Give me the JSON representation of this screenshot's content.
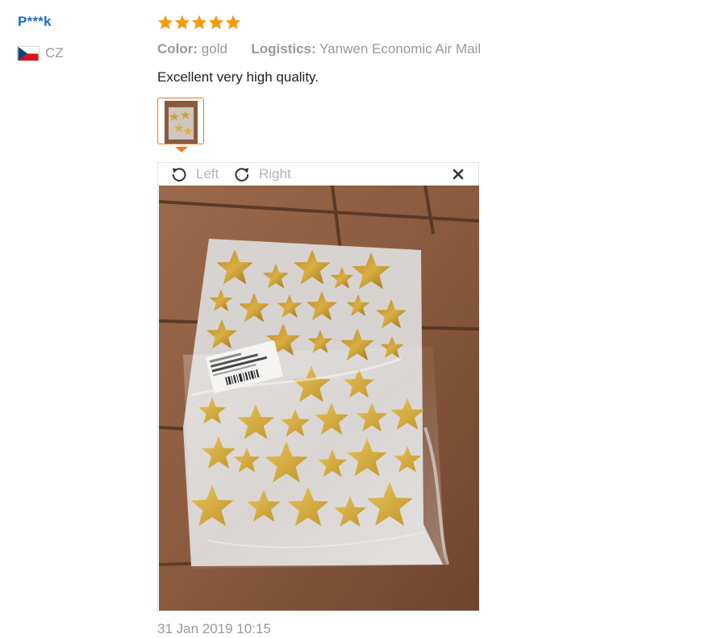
{
  "user": {
    "name": "P***k",
    "country_code": "CZ",
    "flag_icon": "czech-flag-icon"
  },
  "review": {
    "rating": 5,
    "rating_max": 5,
    "star_color": "#f39c12",
    "color_label": "Color:",
    "color_value": "gold",
    "logistics_label": "Logistics:",
    "logistics_value": "Yanwen Economic Air Mail",
    "text": "Excellent very high quality.",
    "date": "31 Jan 2019 10:15"
  },
  "viewer": {
    "rotate_left_label": "Left",
    "rotate_right_label": "Right",
    "rotate_left_icon": "rotate-left-icon",
    "rotate_right_icon": "rotate-right-icon",
    "close_icon": "close-icon",
    "photo_subject": "gold star stickers sheet in plastic bag on tile floor"
  },
  "colors": {
    "accent": "#ee7a22",
    "username": "#1a6fc4",
    "muted_text": "#999999",
    "body_text": "#222222"
  }
}
